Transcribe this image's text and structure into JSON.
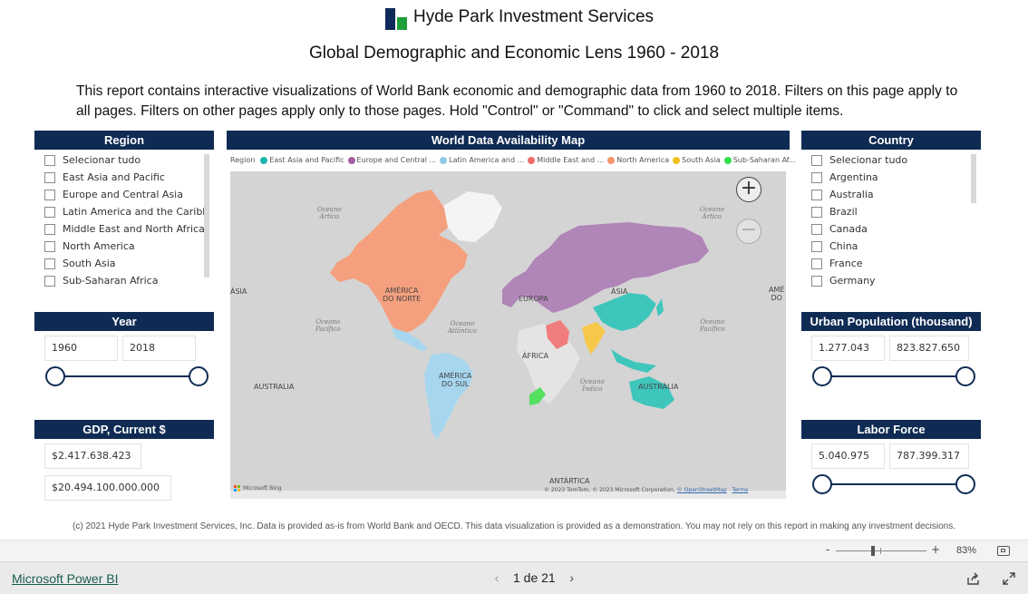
{
  "header": {
    "company": "Hyde Park Investment Services",
    "report_title": "Global Demographic and Economic Lens 1960 - 2018",
    "intro": "This report contains interactive visualizations of World Bank economic and demographic data from 1960 to 2018. Filters on this page apply to all pages. Filters on other pages apply only to those pages. Hold \"Control\" or \"Command\" to click and select multiple items."
  },
  "region_slicer": {
    "title": "Region",
    "items": [
      "Selecionar tudo",
      "East Asia and Pacific",
      "Europe and Central Asia",
      "Latin America and the Caribb...",
      "Middle East and North Africa",
      "North America",
      "South Asia",
      "Sub-Saharan Africa"
    ]
  },
  "country_slicer": {
    "title": "Country",
    "items": [
      "Selecionar tudo",
      "Argentina",
      "Australia",
      "Brazil",
      "Canada",
      "China",
      "France",
      "Germany"
    ]
  },
  "year_slicer": {
    "title": "Year",
    "min": "1960",
    "max": "2018"
  },
  "urban_slicer": {
    "title": "Urban Population (thousand)",
    "min": "1.277.043",
    "max": "823.827.650"
  },
  "gdp_slicer": {
    "title": "GDP, Current $",
    "min": "$2.417.638.423",
    "max": "$20.494.100.000.000"
  },
  "labor_slicer": {
    "title": "Labor Force",
    "min": "5.040.975",
    "max": "787.399.317"
  },
  "map": {
    "title": "World Data Availability Map",
    "legend_title": "Region",
    "legend": [
      {
        "label": "East Asia and Pacific",
        "color": "#1fb5ad"
      },
      {
        "label": "Europe and Central ...",
        "color": "#a25d9f"
      },
      {
        "label": "Latin America and ...",
        "color": "#8ecbe8"
      },
      {
        "label": "Middle East and ...",
        "color": "#f06b6b"
      },
      {
        "label": "North America",
        "color": "#f4956a"
      },
      {
        "label": "South Asia",
        "color": "#f2c01b"
      },
      {
        "label": "Sub-Saharan Af...",
        "color": "#34e04a"
      }
    ],
    "oceans": {
      "arctic_left": "Oceano\nÁrtico",
      "arctic_right": "Oceano\nÁrtico",
      "pacific_left": "Oceano\nPacífico",
      "pacific_right": "Oceano\nPacífico",
      "atlantic": "Oceano\nAtlântico",
      "indian": "Oceano\nÍndico"
    },
    "labels": {
      "north_america": "AMÉRICA\nDO NORTE",
      "south_america": "AMÉRICA\nDO SUL",
      "europe": "EUROPA",
      "asia": "ÁSIA",
      "asia_left": "ÁSIA",
      "america_right": "AMÉ\nDO",
      "africa": "ÁFRICA",
      "australia": "AUSTRÁLIA",
      "australia_left": "AUSTRALIA",
      "antarctica": "ANTÁRTICA"
    },
    "bing": "Microsoft Bing",
    "attribution": "© 2023 TomTom, © 2023 Microsoft Corporation,",
    "osm": "© OpenStreetMap",
    "terms": "Terms",
    "zoom_in": "+",
    "zoom_out": "−"
  },
  "footer_note": "(c) 2021 Hyde Park Investment Services, Inc. Data is provided as-is from World Bank and OECD. This data visualization is provided as a demonstration. You may not rely on this report in making any investment decisions.",
  "zoom_bar": {
    "minus": "-",
    "plus": "+",
    "zoom_level": "83%",
    "zoom_fraction": 0.55
  },
  "bottom_bar": {
    "powerbi_link": "Microsoft Power BI",
    "page_indicator": "1 de 21",
    "prev": "‹",
    "next": "›"
  }
}
